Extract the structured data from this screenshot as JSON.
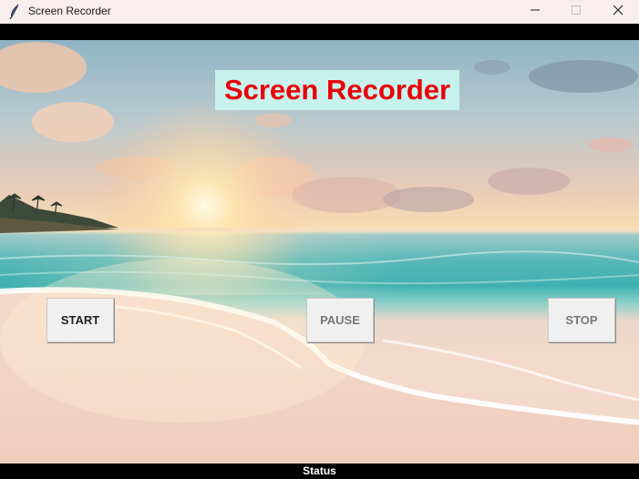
{
  "window": {
    "title": "Screen Recorder",
    "controls": {
      "minimize_icon": "minimize-icon",
      "maximize_icon": "maximize-icon",
      "close_icon": "close-icon"
    }
  },
  "main": {
    "heading": "Screen Recorder",
    "background_image": "beach-sunset",
    "buttons": {
      "start": "START",
      "pause": "PAUSE",
      "stop": "STOP"
    }
  },
  "status": {
    "text": "Status"
  },
  "colors": {
    "heading_text": "#e8000b",
    "heading_bg": "#c8f2ec",
    "titlebar_bg": "#f8eeee",
    "button_bg": "#f0f0f0",
    "status_bg": "#000000",
    "status_text": "#ffffff"
  }
}
